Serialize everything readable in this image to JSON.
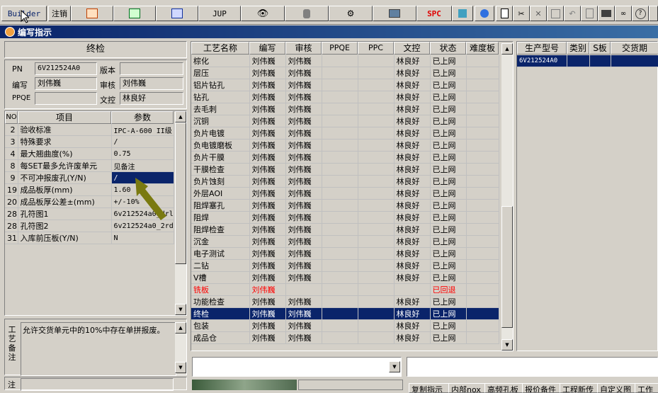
{
  "toolbar": {
    "builder": "Builder",
    "logout": "注销",
    "jup": "JUP",
    "spc": "SPC"
  },
  "window": {
    "title": "编写指示"
  },
  "left": {
    "header": "终检",
    "pn_label": "PN",
    "pn_value": "6V212524A0",
    "version_label": "版本",
    "version_value": "",
    "writer_label": "编写",
    "writer_value": "刘伟巍",
    "review_label": "审核",
    "review_value": "刘伟巍",
    "ppqe_label": "PPQE",
    "ppqe_value": "",
    "doc_label": "文控",
    "doc_value": "林良好",
    "param_headers": [
      "NO",
      "项目",
      "参数"
    ],
    "params": [
      {
        "no": "2",
        "item": "验收标准",
        "value": "IPC-A-600 II级"
      },
      {
        "no": "3",
        "item": "特殊要求",
        "value": "/"
      },
      {
        "no": "4",
        "item": "最大翘曲度(%)",
        "value": "0.75"
      },
      {
        "no": "8",
        "item": "每SET最多允许废单元",
        "value": "见备注"
      },
      {
        "no": "9",
        "item": "不可冲报废孔(Y/N)",
        "value": "/"
      },
      {
        "no": "19",
        "item": "成品板厚(mm)",
        "value": "1.60"
      },
      {
        "no": "20",
        "item": "成品板厚公差±(mm)",
        "value": "+/-10%"
      },
      {
        "no": "28",
        "item": "孔符图1",
        "value": "6v212524a0_drl"
      },
      {
        "no": "28",
        "item": "孔符图2",
        "value": "6v212524a0_2rd"
      },
      {
        "no": "31",
        "item": "入库前压板(Y/N)",
        "value": "N"
      }
    ],
    "remark_label": "工艺备注",
    "remark_text": "允许交货单元中的10%中存在单拼报废。",
    "bottom_label": "注"
  },
  "process": {
    "headers": [
      "工艺名称",
      "编写",
      "审核",
      "PPQE",
      "PPC",
      "文控",
      "状态",
      "难度板"
    ],
    "rows": [
      {
        "name": "棕化",
        "writer": "刘伟巍",
        "review": "刘伟巍",
        "ppqe": "",
        "ppc": "",
        "doc": "林良好",
        "status": "已上网"
      },
      {
        "name": "层压",
        "writer": "刘伟巍",
        "review": "刘伟巍",
        "ppqe": "",
        "ppc": "",
        "doc": "林良好",
        "status": "已上网"
      },
      {
        "name": "铝片钻孔",
        "writer": "刘伟巍",
        "review": "刘伟巍",
        "ppqe": "",
        "ppc": "",
        "doc": "林良好",
        "status": "已上网"
      },
      {
        "name": "钻孔",
        "writer": "刘伟巍",
        "review": "刘伟巍",
        "ppqe": "",
        "ppc": "",
        "doc": "林良好",
        "status": "已上网"
      },
      {
        "name": "去毛刺",
        "writer": "刘伟巍",
        "review": "刘伟巍",
        "ppqe": "",
        "ppc": "",
        "doc": "林良好",
        "status": "已上网"
      },
      {
        "name": "沉铜",
        "writer": "刘伟巍",
        "review": "刘伟巍",
        "ppqe": "",
        "ppc": "",
        "doc": "林良好",
        "status": "已上网"
      },
      {
        "name": "负片电镀",
        "writer": "刘伟巍",
        "review": "刘伟巍",
        "ppqe": "",
        "ppc": "",
        "doc": "林良好",
        "status": "已上网"
      },
      {
        "name": "负电镀磨板",
        "writer": "刘伟巍",
        "review": "刘伟巍",
        "ppqe": "",
        "ppc": "",
        "doc": "林良好",
        "status": "已上网"
      },
      {
        "name": "负片干膜",
        "writer": "刘伟巍",
        "review": "刘伟巍",
        "ppqe": "",
        "ppc": "",
        "doc": "林良好",
        "status": "已上网"
      },
      {
        "name": "干膜检查",
        "writer": "刘伟巍",
        "review": "刘伟巍",
        "ppqe": "",
        "ppc": "",
        "doc": "林良好",
        "status": "已上网"
      },
      {
        "name": "负片蚀刻",
        "writer": "刘伟巍",
        "review": "刘伟巍",
        "ppqe": "",
        "ppc": "",
        "doc": "林良好",
        "status": "已上网"
      },
      {
        "name": "外层AOI",
        "writer": "刘伟巍",
        "review": "刘伟巍",
        "ppqe": "",
        "ppc": "",
        "doc": "林良好",
        "status": "已上网"
      },
      {
        "name": "阻焊塞孔",
        "writer": "刘伟巍",
        "review": "刘伟巍",
        "ppqe": "",
        "ppc": "",
        "doc": "林良好",
        "status": "已上网"
      },
      {
        "name": "阻焊",
        "writer": "刘伟巍",
        "review": "刘伟巍",
        "ppqe": "",
        "ppc": "",
        "doc": "林良好",
        "status": "已上网"
      },
      {
        "name": "阻焊检查",
        "writer": "刘伟巍",
        "review": "刘伟巍",
        "ppqe": "",
        "ppc": "",
        "doc": "林良好",
        "status": "已上网"
      },
      {
        "name": "沉金",
        "writer": "刘伟巍",
        "review": "刘伟巍",
        "ppqe": "",
        "ppc": "",
        "doc": "林良好",
        "status": "已上网"
      },
      {
        "name": "电子测试",
        "writer": "刘伟巍",
        "review": "刘伟巍",
        "ppqe": "",
        "ppc": "",
        "doc": "林良好",
        "status": "已上网"
      },
      {
        "name": "二钻",
        "writer": "刘伟巍",
        "review": "刘伟巍",
        "ppqe": "",
        "ppc": "",
        "doc": "林良好",
        "status": "已上网"
      },
      {
        "name": "V槽",
        "writer": "刘伟巍",
        "review": "刘伟巍",
        "ppqe": "",
        "ppc": "",
        "doc": "林良好",
        "status": "已上网"
      },
      {
        "name": "铣板",
        "writer": "刘伟巍",
        "review": "",
        "ppqe": "",
        "ppc": "",
        "doc": "",
        "status": "已回退",
        "red": true
      },
      {
        "name": "功能检查",
        "writer": "刘伟巍",
        "review": "刘伟巍",
        "ppqe": "",
        "ppc": "",
        "doc": "林良好",
        "status": "已上网"
      },
      {
        "name": "终检",
        "writer": "刘伟巍",
        "review": "刘伟巍",
        "ppqe": "",
        "ppc": "",
        "doc": "林良好",
        "status": "已上网",
        "selected": true
      },
      {
        "name": "包装",
        "writer": "刘伟巍",
        "review": "刘伟巍",
        "ppqe": "",
        "ppc": "",
        "doc": "林良好",
        "status": "已上网"
      },
      {
        "name": "成品仓",
        "writer": "刘伟巍",
        "review": "刘伟巍",
        "ppqe": "",
        "ppc": "",
        "doc": "林良好",
        "status": "已上网"
      }
    ]
  },
  "right": {
    "headers": [
      "生产型号",
      "类别",
      "S板",
      "交货期"
    ],
    "rows": [
      {
        "model": "6V212524A0",
        "type": "",
        "s": "",
        "date": ""
      }
    ]
  },
  "bottom_tabs": [
    "复制指示",
    "内部nox",
    "高频孔板",
    "报价备件",
    "工程新传",
    "自定义图",
    "工作"
  ],
  "colors": {
    "title_start": "#0a246a",
    "selected": "#0a246a",
    "rollback": "#ff0000",
    "face": "#d4d0c8"
  }
}
